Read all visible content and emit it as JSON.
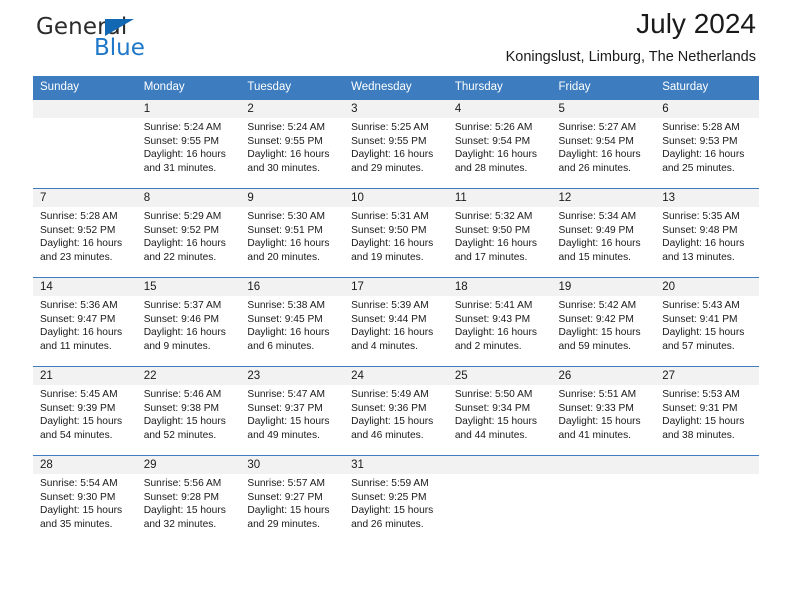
{
  "brand": {
    "name_top": "General",
    "name_bottom": "Blue",
    "accent_color": "#1e77c8",
    "triangle_color": "#1268b3"
  },
  "header": {
    "title": "July 2024",
    "subtitle": "Koningslust, Limburg, The Netherlands"
  },
  "theme": {
    "header_bg": "#3c7cbf",
    "header_text": "#ffffff",
    "daynum_band_bg": "#f2f2f2",
    "cell_bg": "#ffffff",
    "text": "#1a1a1a"
  },
  "calendar": {
    "weekday_headers": [
      "Sunday",
      "Monday",
      "Tuesday",
      "Wednesday",
      "Thursday",
      "Friday",
      "Saturday"
    ],
    "weeks": [
      [
        {
          "day": "",
          "sunrise": "",
          "sunset": "",
          "daylight_line1": "",
          "daylight_line2": ""
        },
        {
          "day": "1",
          "sunrise": "Sunrise: 5:24 AM",
          "sunset": "Sunset: 9:55 PM",
          "daylight_line1": "Daylight: 16 hours",
          "daylight_line2": "and 31 minutes."
        },
        {
          "day": "2",
          "sunrise": "Sunrise: 5:24 AM",
          "sunset": "Sunset: 9:55 PM",
          "daylight_line1": "Daylight: 16 hours",
          "daylight_line2": "and 30 minutes."
        },
        {
          "day": "3",
          "sunrise": "Sunrise: 5:25 AM",
          "sunset": "Sunset: 9:55 PM",
          "daylight_line1": "Daylight: 16 hours",
          "daylight_line2": "and 29 minutes."
        },
        {
          "day": "4",
          "sunrise": "Sunrise: 5:26 AM",
          "sunset": "Sunset: 9:54 PM",
          "daylight_line1": "Daylight: 16 hours",
          "daylight_line2": "and 28 minutes."
        },
        {
          "day": "5",
          "sunrise": "Sunrise: 5:27 AM",
          "sunset": "Sunset: 9:54 PM",
          "daylight_line1": "Daylight: 16 hours",
          "daylight_line2": "and 26 minutes."
        },
        {
          "day": "6",
          "sunrise": "Sunrise: 5:28 AM",
          "sunset": "Sunset: 9:53 PM",
          "daylight_line1": "Daylight: 16 hours",
          "daylight_line2": "and 25 minutes."
        }
      ],
      [
        {
          "day": "7",
          "sunrise": "Sunrise: 5:28 AM",
          "sunset": "Sunset: 9:52 PM",
          "daylight_line1": "Daylight: 16 hours",
          "daylight_line2": "and 23 minutes."
        },
        {
          "day": "8",
          "sunrise": "Sunrise: 5:29 AM",
          "sunset": "Sunset: 9:52 PM",
          "daylight_line1": "Daylight: 16 hours",
          "daylight_line2": "and 22 minutes."
        },
        {
          "day": "9",
          "sunrise": "Sunrise: 5:30 AM",
          "sunset": "Sunset: 9:51 PM",
          "daylight_line1": "Daylight: 16 hours",
          "daylight_line2": "and 20 minutes."
        },
        {
          "day": "10",
          "sunrise": "Sunrise: 5:31 AM",
          "sunset": "Sunset: 9:50 PM",
          "daylight_line1": "Daylight: 16 hours",
          "daylight_line2": "and 19 minutes."
        },
        {
          "day": "11",
          "sunrise": "Sunrise: 5:32 AM",
          "sunset": "Sunset: 9:50 PM",
          "daylight_line1": "Daylight: 16 hours",
          "daylight_line2": "and 17 minutes."
        },
        {
          "day": "12",
          "sunrise": "Sunrise: 5:34 AM",
          "sunset": "Sunset: 9:49 PM",
          "daylight_line1": "Daylight: 16 hours",
          "daylight_line2": "and 15 minutes."
        },
        {
          "day": "13",
          "sunrise": "Sunrise: 5:35 AM",
          "sunset": "Sunset: 9:48 PM",
          "daylight_line1": "Daylight: 16 hours",
          "daylight_line2": "and 13 minutes."
        }
      ],
      [
        {
          "day": "14",
          "sunrise": "Sunrise: 5:36 AM",
          "sunset": "Sunset: 9:47 PM",
          "daylight_line1": "Daylight: 16 hours",
          "daylight_line2": "and 11 minutes."
        },
        {
          "day": "15",
          "sunrise": "Sunrise: 5:37 AM",
          "sunset": "Sunset: 9:46 PM",
          "daylight_line1": "Daylight: 16 hours",
          "daylight_line2": "and 9 minutes."
        },
        {
          "day": "16",
          "sunrise": "Sunrise: 5:38 AM",
          "sunset": "Sunset: 9:45 PM",
          "daylight_line1": "Daylight: 16 hours",
          "daylight_line2": "and 6 minutes."
        },
        {
          "day": "17",
          "sunrise": "Sunrise: 5:39 AM",
          "sunset": "Sunset: 9:44 PM",
          "daylight_line1": "Daylight: 16 hours",
          "daylight_line2": "and 4 minutes."
        },
        {
          "day": "18",
          "sunrise": "Sunrise: 5:41 AM",
          "sunset": "Sunset: 9:43 PM",
          "daylight_line1": "Daylight: 16 hours",
          "daylight_line2": "and 2 minutes."
        },
        {
          "day": "19",
          "sunrise": "Sunrise: 5:42 AM",
          "sunset": "Sunset: 9:42 PM",
          "daylight_line1": "Daylight: 15 hours",
          "daylight_line2": "and 59 minutes."
        },
        {
          "day": "20",
          "sunrise": "Sunrise: 5:43 AM",
          "sunset": "Sunset: 9:41 PM",
          "daylight_line1": "Daylight: 15 hours",
          "daylight_line2": "and 57 minutes."
        }
      ],
      [
        {
          "day": "21",
          "sunrise": "Sunrise: 5:45 AM",
          "sunset": "Sunset: 9:39 PM",
          "daylight_line1": "Daylight: 15 hours",
          "daylight_line2": "and 54 minutes."
        },
        {
          "day": "22",
          "sunrise": "Sunrise: 5:46 AM",
          "sunset": "Sunset: 9:38 PM",
          "daylight_line1": "Daylight: 15 hours",
          "daylight_line2": "and 52 minutes."
        },
        {
          "day": "23",
          "sunrise": "Sunrise: 5:47 AM",
          "sunset": "Sunset: 9:37 PM",
          "daylight_line1": "Daylight: 15 hours",
          "daylight_line2": "and 49 minutes."
        },
        {
          "day": "24",
          "sunrise": "Sunrise: 5:49 AM",
          "sunset": "Sunset: 9:36 PM",
          "daylight_line1": "Daylight: 15 hours",
          "daylight_line2": "and 46 minutes."
        },
        {
          "day": "25",
          "sunrise": "Sunrise: 5:50 AM",
          "sunset": "Sunset: 9:34 PM",
          "daylight_line1": "Daylight: 15 hours",
          "daylight_line2": "and 44 minutes."
        },
        {
          "day": "26",
          "sunrise": "Sunrise: 5:51 AM",
          "sunset": "Sunset: 9:33 PM",
          "daylight_line1": "Daylight: 15 hours",
          "daylight_line2": "and 41 minutes."
        },
        {
          "day": "27",
          "sunrise": "Sunrise: 5:53 AM",
          "sunset": "Sunset: 9:31 PM",
          "daylight_line1": "Daylight: 15 hours",
          "daylight_line2": "and 38 minutes."
        }
      ],
      [
        {
          "day": "28",
          "sunrise": "Sunrise: 5:54 AM",
          "sunset": "Sunset: 9:30 PM",
          "daylight_line1": "Daylight: 15 hours",
          "daylight_line2": "and 35 minutes."
        },
        {
          "day": "29",
          "sunrise": "Sunrise: 5:56 AM",
          "sunset": "Sunset: 9:28 PM",
          "daylight_line1": "Daylight: 15 hours",
          "daylight_line2": "and 32 minutes."
        },
        {
          "day": "30",
          "sunrise": "Sunrise: 5:57 AM",
          "sunset": "Sunset: 9:27 PM",
          "daylight_line1": "Daylight: 15 hours",
          "daylight_line2": "and 29 minutes."
        },
        {
          "day": "31",
          "sunrise": "Sunrise: 5:59 AM",
          "sunset": "Sunset: 9:25 PM",
          "daylight_line1": "Daylight: 15 hours",
          "daylight_line2": "and 26 minutes."
        },
        {
          "day": "",
          "sunrise": "",
          "sunset": "",
          "daylight_line1": "",
          "daylight_line2": ""
        },
        {
          "day": "",
          "sunrise": "",
          "sunset": "",
          "daylight_line1": "",
          "daylight_line2": ""
        },
        {
          "day": "",
          "sunrise": "",
          "sunset": "",
          "daylight_line1": "",
          "daylight_line2": ""
        }
      ]
    ]
  }
}
